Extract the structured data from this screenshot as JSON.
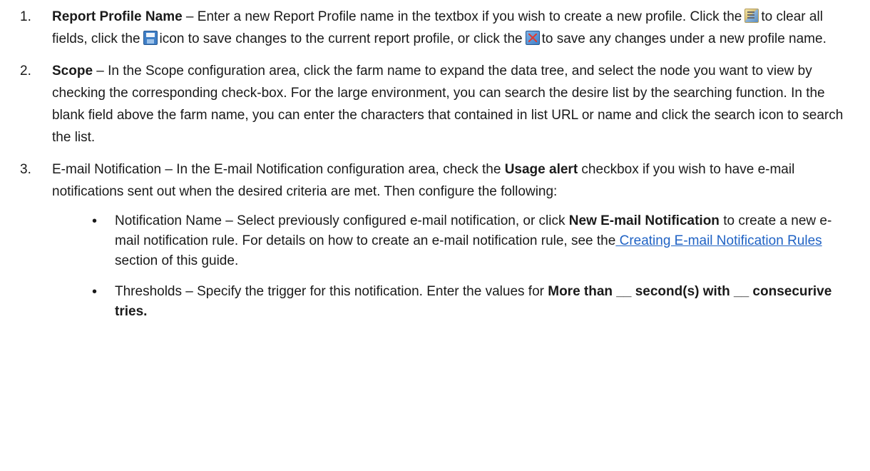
{
  "items": [
    {
      "number": "1.",
      "title": "Report Profile Name",
      "text_a": " – Enter a new Report Profile name in the textbox if you wish to create a new profile. Click the",
      "clear_icon": "clear-fields-icon",
      "text_b": "to clear all fields, click the",
      "save_icon": "save-icon",
      "text_c": "icon to save changes to the current report profile, or click the",
      "saveas_icon": "save-as-icon",
      "text_d": "to save any changes under a new profile name."
    },
    {
      "number": "2.",
      "title": "Scope",
      "text": " – In the Scope configuration area, click the farm name to expand the data tree, and select the node you want to view by checking the corresponding check-box. For the large environment, you can search the desire list by the searching function. In the blank field above the farm name, you can enter the characters that contained in list URL or name and click the search icon to search the list."
    },
    {
      "number": "3.",
      "text_a": "E-mail Notification – In the E-mail Notification configuration area, check the ",
      "bold_a": "Usage alert",
      "text_b": " checkbox if you wish to have e-mail notifications sent out when the desired criteria are met. Then configure the following:"
    }
  ],
  "sub_items": [
    {
      "bullet": "•",
      "text_a": "Notification Name – Select previously configured e-mail notification, or click ",
      "bold_a": "New E-mail Notification",
      "text_b": " to create a new e-mail notification rule. For details on how to create an e-mail notification rule, see the",
      "link": " Creating E-mail Notification Rules",
      "text_c": " section of this guide."
    },
    {
      "bullet": "•",
      "text_a": "Thresholds – Specify the trigger for this notification. Enter the values for ",
      "bold_a": "More than __ second(s) with __ consecurive tries."
    }
  ]
}
